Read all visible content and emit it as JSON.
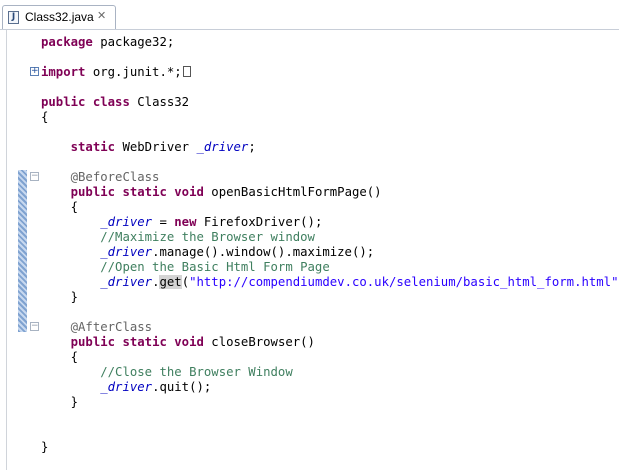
{
  "tab": {
    "title": "Class32.java"
  },
  "code": {
    "package_kw": "package",
    "package_name": " package32;",
    "import_kw": "import",
    "import_name": " org.junit.*;",
    "public_kw": "public",
    "class_kw": "class",
    "class_name": " Class32",
    "open_brace": "{",
    "close_brace": "}",
    "static_kw": "static",
    "void_kw": "void",
    "new_kw": "new",
    "webdriver_type": " WebDriver ",
    "driver_field": "_driver",
    "semicolon": ";",
    "before_class": "@BeforeClass",
    "after_class": "@AfterClass",
    "open_method": " openBasicHtmlFormPage()",
    "close_method": " closeBrowser()",
    "assign": " = ",
    "firefox_ctor": " FirefoxDriver();",
    "comment_maximize": "//Maximize the Browser window",
    "manage_chain": ".manage().window().maximize();",
    "comment_open": "//Open the Basic Html Form Page",
    "dot": ".",
    "get_call": "get",
    "paren_open": "(",
    "url_string": "\"http://compendiumdev.co.uk/selenium/basic_html_form.html\"",
    "paren_close": ");",
    "comment_close": "//Close the Browser Window",
    "quit_call": ".quit();"
  }
}
